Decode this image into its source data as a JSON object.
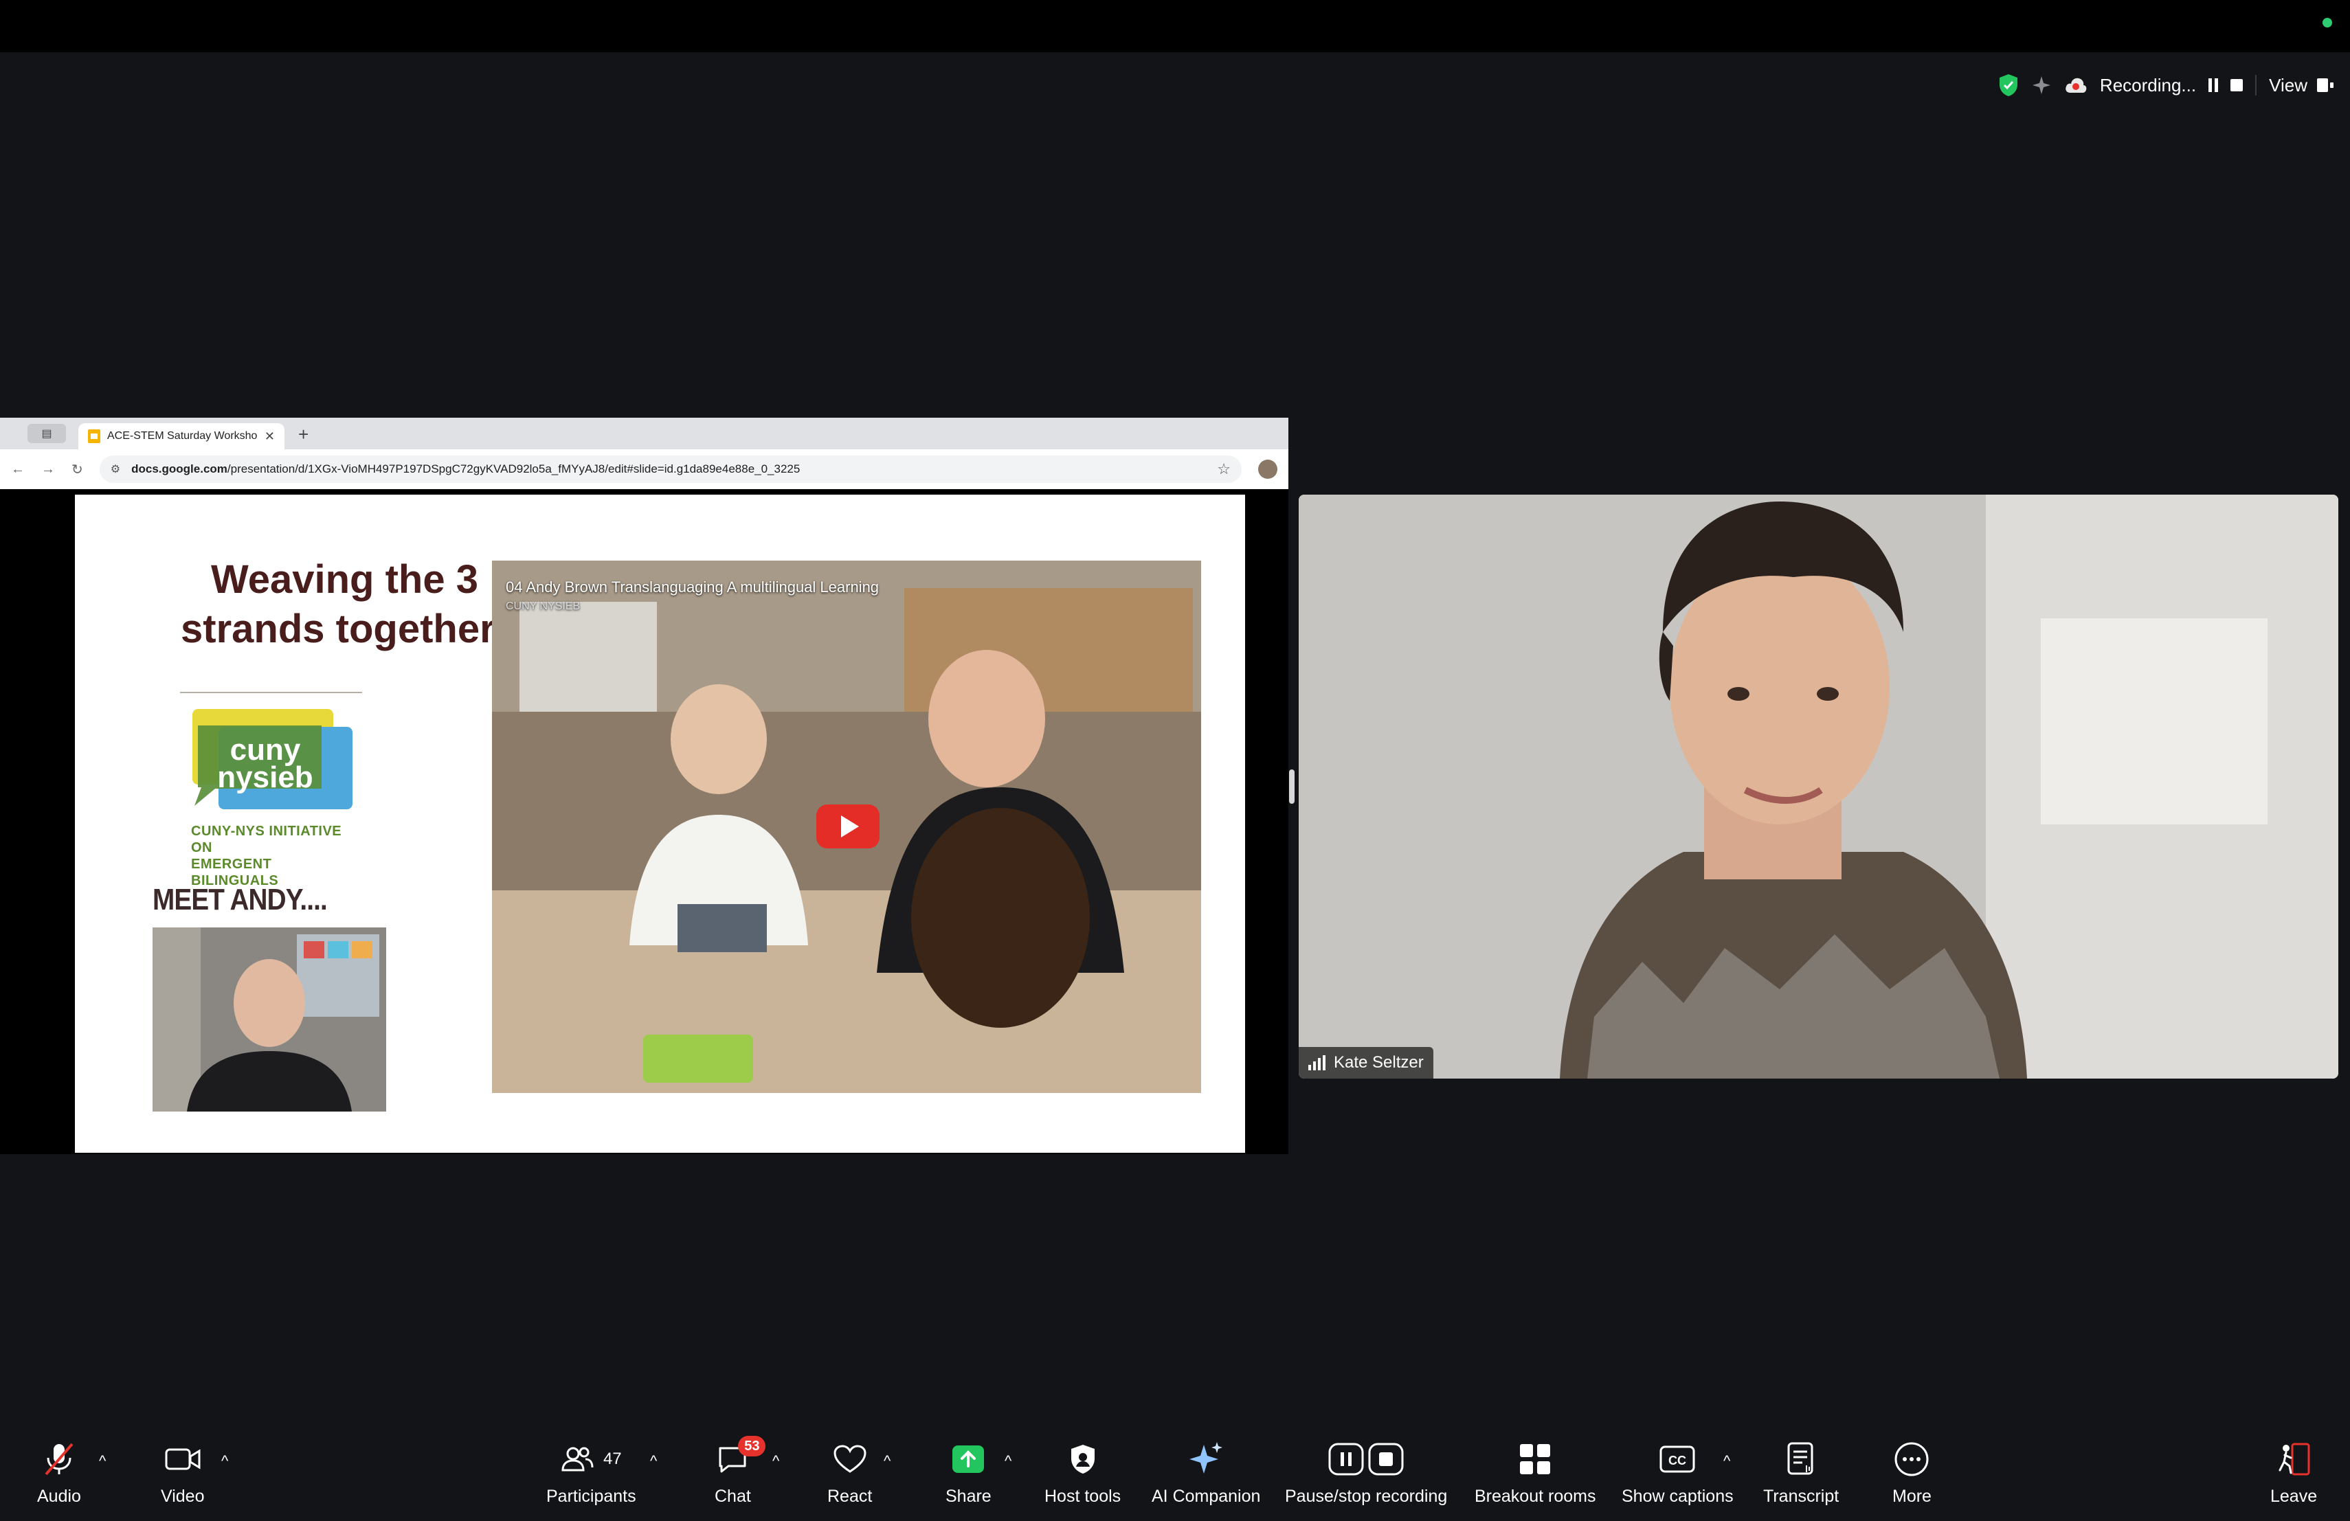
{
  "status_bar": {
    "recording_label": "Recording...",
    "view_label": "View"
  },
  "browser": {
    "tab_title": "ACE-STEM Saturday Worksho",
    "url_host": "docs.google.com",
    "url_path": "/presentation/d/1XGx-VioMH497P197DSpgC72gyKVAD92lo5a_fMYyAJ8/edit#slide=id.g1da89e4e88e_0_3225"
  },
  "slide": {
    "title_line1": "Weaving the 3",
    "title_line2": "strands together!",
    "logo_text_line1": "cuny",
    "logo_text_line2": "nysieb",
    "logo_caption_line1": "CUNY-NYS INITIATIVE ON",
    "logo_caption_line2": "EMERGENT BILINGUALS",
    "meet_label": "MEET ANDY....",
    "video_title": "04 Andy Brown Translanguaging A multilingual Learning",
    "video_channel": "CUNY NYSIEB"
  },
  "speaker": {
    "name": "Kate Seltzer"
  },
  "toolbar": {
    "audio": "Audio",
    "video": "Video",
    "participants": "Participants",
    "participants_count": "47",
    "chat": "Chat",
    "chat_badge": "53",
    "react": "React",
    "share": "Share",
    "host_tools": "Host tools",
    "ai_companion": "AI Companion",
    "pause_stop": "Pause/stop recording",
    "breakout": "Breakout rooms",
    "captions": "Show captions",
    "transcript": "Transcript",
    "more": "More",
    "leave": "Leave"
  },
  "colors": {
    "background": "#131418",
    "slide_title": "#4a1d1d",
    "share_green": "#23c55e",
    "leave_red": "#e5322d",
    "badge_red": "#e5322d"
  }
}
